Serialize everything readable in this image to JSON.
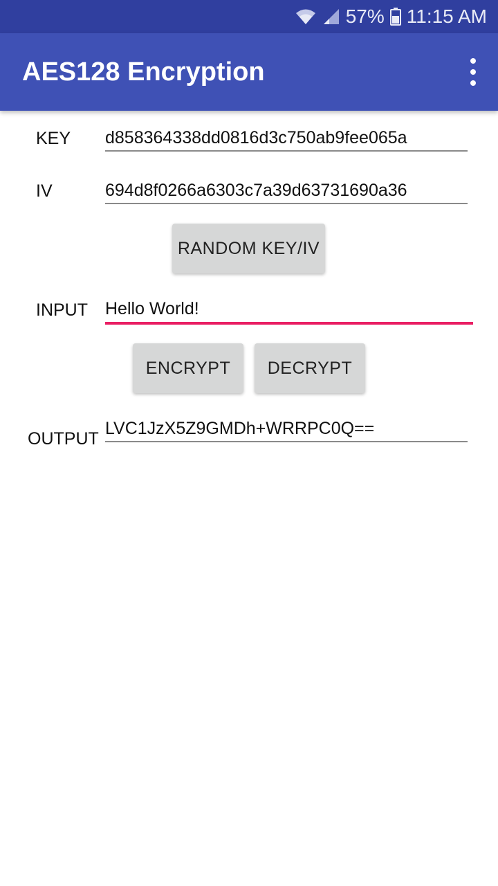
{
  "status_bar": {
    "battery": "57%",
    "time": "11:15 AM",
    "icons": [
      "wifi-icon",
      "signal-icon",
      "battery-icon"
    ]
  },
  "app_bar": {
    "title": "AES128 Encryption",
    "menu_icon": "overflow-menu-icon"
  },
  "form": {
    "key": {
      "label": "KEY",
      "value": "d858364338dd0816d3c750ab9fee065a"
    },
    "iv": {
      "label": "IV",
      "value": "694d8f0266a6303c7a39d63731690a36"
    },
    "random_button": "RANDOM KEY/IV",
    "input": {
      "label": "INPUT",
      "value": "Hello World!"
    },
    "encrypt_button": "ENCRYPT",
    "decrypt_button": "DECRYPT",
    "output": {
      "label": "OUTPUT",
      "value": "LVC1JzX5Z9GMDh+WRRPC0Q=="
    }
  },
  "colors": {
    "status_bar": "#303f9f",
    "app_bar": "#3f51b5",
    "accent": "#e91e63",
    "button": "#d6d7d7"
  }
}
